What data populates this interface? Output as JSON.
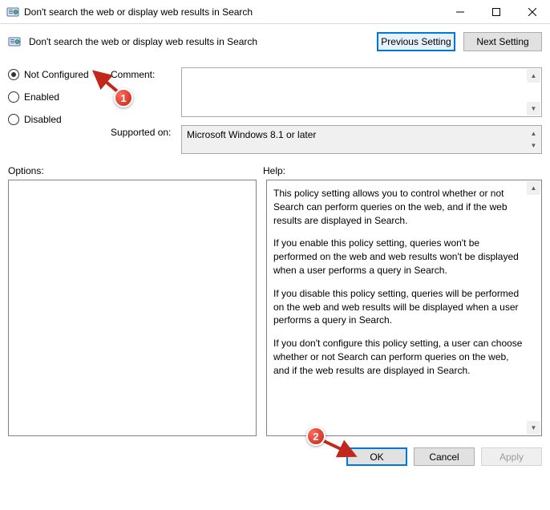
{
  "window": {
    "title": "Don't search the web or display web results in Search"
  },
  "header": {
    "policy_title": "Don't search the web or display web results in Search",
    "prev_btn": "Previous Setting",
    "next_btn": "Next Setting"
  },
  "radios": {
    "not_configured": "Not Configured",
    "enabled": "Enabled",
    "disabled": "Disabled",
    "selected": "not_configured"
  },
  "fields": {
    "comment_label": "Comment:",
    "comment_value": "",
    "supported_label": "Supported on:",
    "supported_value": "Microsoft Windows 8.1 or later"
  },
  "sections": {
    "options_label": "Options:",
    "help_label": "Help:"
  },
  "help": {
    "p1": "This policy setting allows you to control whether or not Search can perform queries on the web, and if the web results are displayed in Search.",
    "p2": "If you enable this policy setting, queries won't be performed on the web and web results won't be displayed when a user performs a query in Search.",
    "p3": "If you disable this policy setting, queries will be performed on the web and web results will be displayed when a user performs a query in Search.",
    "p4": "If you don't configure this policy setting, a user can choose whether or not Search can perform queries on the web, and if the web results are displayed in Search."
  },
  "footer": {
    "ok": "OK",
    "cancel": "Cancel",
    "apply": "Apply"
  },
  "annotations": {
    "badge1": "1",
    "badge2": "2"
  }
}
